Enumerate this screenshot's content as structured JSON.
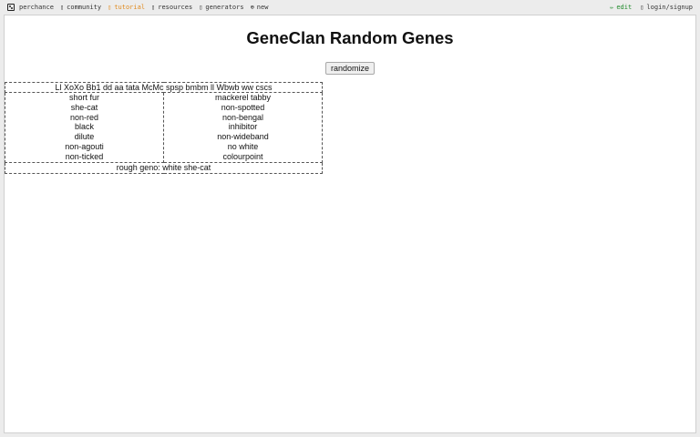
{
  "nav": {
    "left": [
      {
        "icon": "dice-icon",
        "label": "perchance"
      },
      {
        "icon": "community-icon",
        "label": "community"
      },
      {
        "icon": "tutorial-icon",
        "label": "tutorial"
      },
      {
        "icon": "resources-icon",
        "label": "resources"
      },
      {
        "icon": "generators-icon",
        "label": "generators"
      },
      {
        "icon": "plus-circle-icon",
        "label": "new"
      }
    ],
    "right": [
      {
        "icon": "pencil-icon",
        "glyph": "✏",
        "label": "edit"
      },
      {
        "icon": "user-icon",
        "label": "login/signup"
      }
    ]
  },
  "page": {
    "title": "GeneClan Random Genes",
    "randomize_label": "randomize"
  },
  "genes": {
    "genotype": "Ll XoXo Bb1 dd aa tata McMc spsp bmbm ll Wbwb ww cscs",
    "left": [
      "short fur",
      "she-cat",
      "non-red",
      "black",
      "dilute",
      "non-agouti",
      "non-ticked"
    ],
    "right": [
      "mackerel tabby",
      "non-spotted",
      "non-bengal",
      "inhibitor",
      "non-wideband",
      "no white",
      "colourpoint"
    ],
    "rough_geno": "rough geno: white she-cat"
  },
  "colors": {
    "tutorial": "#e08a1e",
    "edit": "#1f8a2a"
  }
}
